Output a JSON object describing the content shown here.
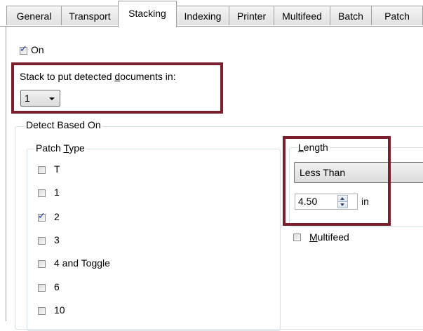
{
  "tabs": [
    {
      "label": "General",
      "active": false
    },
    {
      "label": "Transport",
      "active": false
    },
    {
      "label": "Stacking",
      "active": true
    },
    {
      "label": "Indexing",
      "active": false
    },
    {
      "label": "Printer",
      "active": false
    },
    {
      "label": "Multifeed",
      "active": false
    },
    {
      "label": "Batch",
      "active": false
    },
    {
      "label": "Patch",
      "active": false
    }
  ],
  "on_checkbox": {
    "label": "On",
    "checked": true
  },
  "stack": {
    "label_pre": "Stack to put detected ",
    "label_accel": "d",
    "label_post": "ocuments in:",
    "selected": "1"
  },
  "detect_group": {
    "legend": "Detect Based On"
  },
  "patch_type": {
    "legend_pre": "Patch ",
    "legend_accel": "T",
    "legend_post": "ype",
    "items": [
      {
        "label": "T",
        "checked": false
      },
      {
        "label": "1",
        "checked": false
      },
      {
        "label": "2",
        "checked": true
      },
      {
        "label": "3",
        "checked": false
      },
      {
        "label": "4 and Toggle",
        "checked": false
      },
      {
        "label": "6",
        "checked": false
      },
      {
        "label": "10",
        "checked": false
      }
    ]
  },
  "length": {
    "legend_accel": "L",
    "legend_post": "ength",
    "comparison": "Less Than",
    "value": "4.50",
    "unit": "in"
  },
  "multifeed_checkbox": {
    "label_accel": "M",
    "label_post": "ultifeed",
    "checked": false
  },
  "colors": {
    "highlight": "#7b1e2d",
    "group_border": "#d5dfe5",
    "check": "#2a3e9a"
  }
}
